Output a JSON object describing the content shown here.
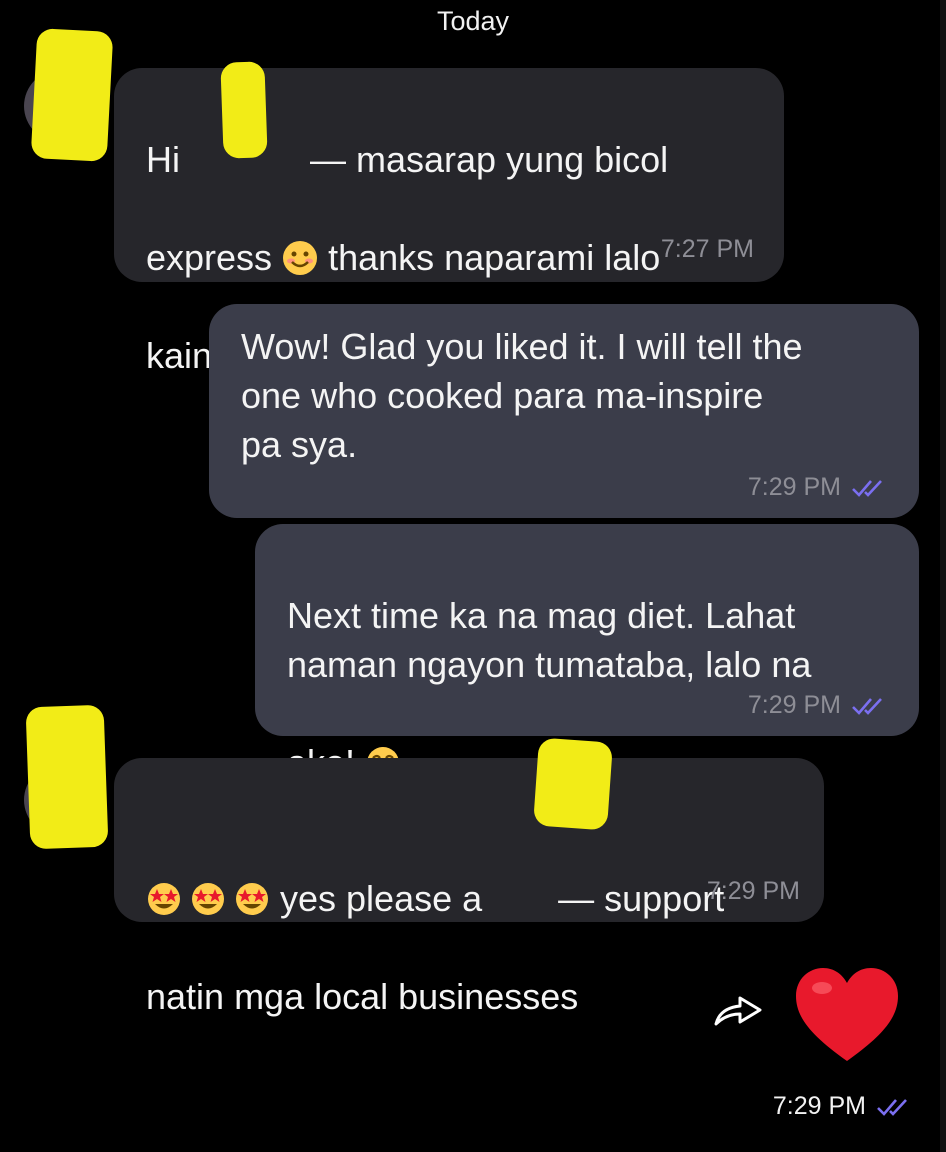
{
  "date_separator": "Today",
  "messages": [
    {
      "direction": "incoming",
      "line1_pre": "Hi ",
      "line1_post": "— masarap yung bicol",
      "line2_pre": "express ",
      "line2_post": " thanks naparami lalo",
      "line3": "kain ko",
      "emoji": "smiling-face-emoji",
      "time": "7:27 PM"
    },
    {
      "direction": "outgoing",
      "text": "Wow! Glad you liked it. I will tell the\none who cooked para ma-inspire\npa sya.",
      "time": "7:29 PM",
      "status": "read-double-check"
    },
    {
      "direction": "outgoing",
      "text": "Next time ka na mag diet. Lahat\nnaman ngayon tumataba, lalo na",
      "line3": "ako! ",
      "emoji": "tears-of-joy-emoji",
      "time": "7:29 PM",
      "status": "read-double-check"
    },
    {
      "direction": "incoming",
      "line1_pre": " yes please a",
      "line1_post": "— support",
      "line2": "natin mga local businesses",
      "emoji": "star-struck-emoji",
      "time": "7:29 PM"
    }
  ],
  "reaction": {
    "icon": "red-heart-icon",
    "forward_icon": "forward-icon",
    "time": "7:29 PM",
    "status": "read-double-check"
  },
  "colors": {
    "background": "#000000",
    "incoming_bubble": "#26262b",
    "outgoing_bubble": "#3b3d4a",
    "read_ticks": "#7b6ff0",
    "heart": "#e8192c",
    "redaction": "#f2ec17"
  }
}
